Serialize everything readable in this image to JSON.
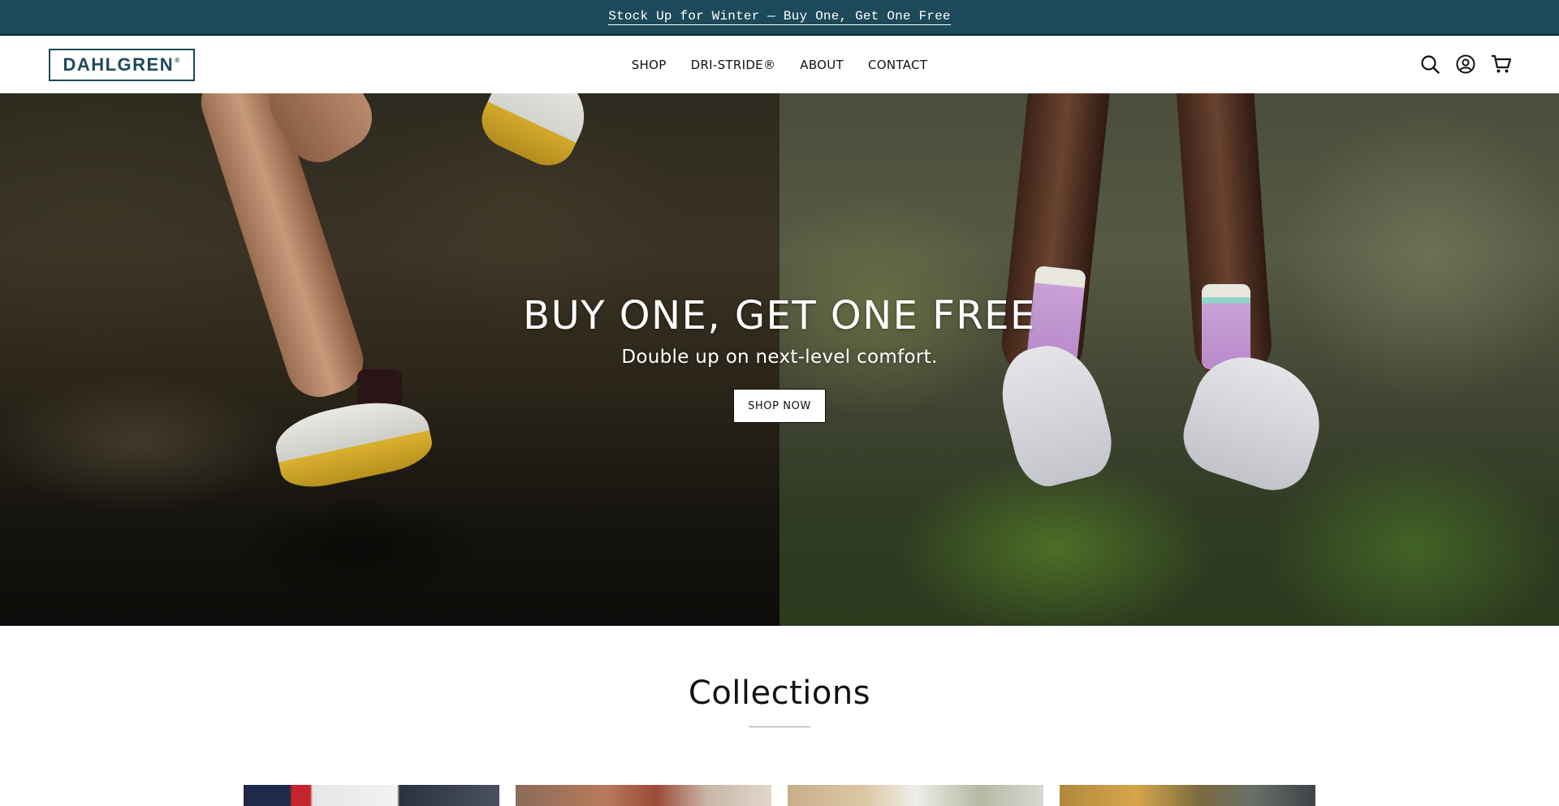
{
  "announcement": {
    "text": "Stock Up for Winter — Buy One, Get One Free"
  },
  "header": {
    "logo_text": "DAHLGREN",
    "logo_mark": "®",
    "nav": [
      {
        "label": "SHOP"
      },
      {
        "label": "DRI-STRIDE®"
      },
      {
        "label": "ABOUT"
      },
      {
        "label": "CONTACT"
      }
    ],
    "icons": [
      "search-icon",
      "account-icon",
      "cart-icon"
    ]
  },
  "hero": {
    "title": "BUY ONE, GET ONE FREE",
    "subtitle": "Double up on next-level comfort.",
    "button_label": "SHOP NOW"
  },
  "collections": {
    "heading": "Collections"
  },
  "colors": {
    "brand": "#1d4a5a",
    "announcement_bg": "#1d4a5a",
    "white": "#ffffff",
    "text": "#111111"
  }
}
